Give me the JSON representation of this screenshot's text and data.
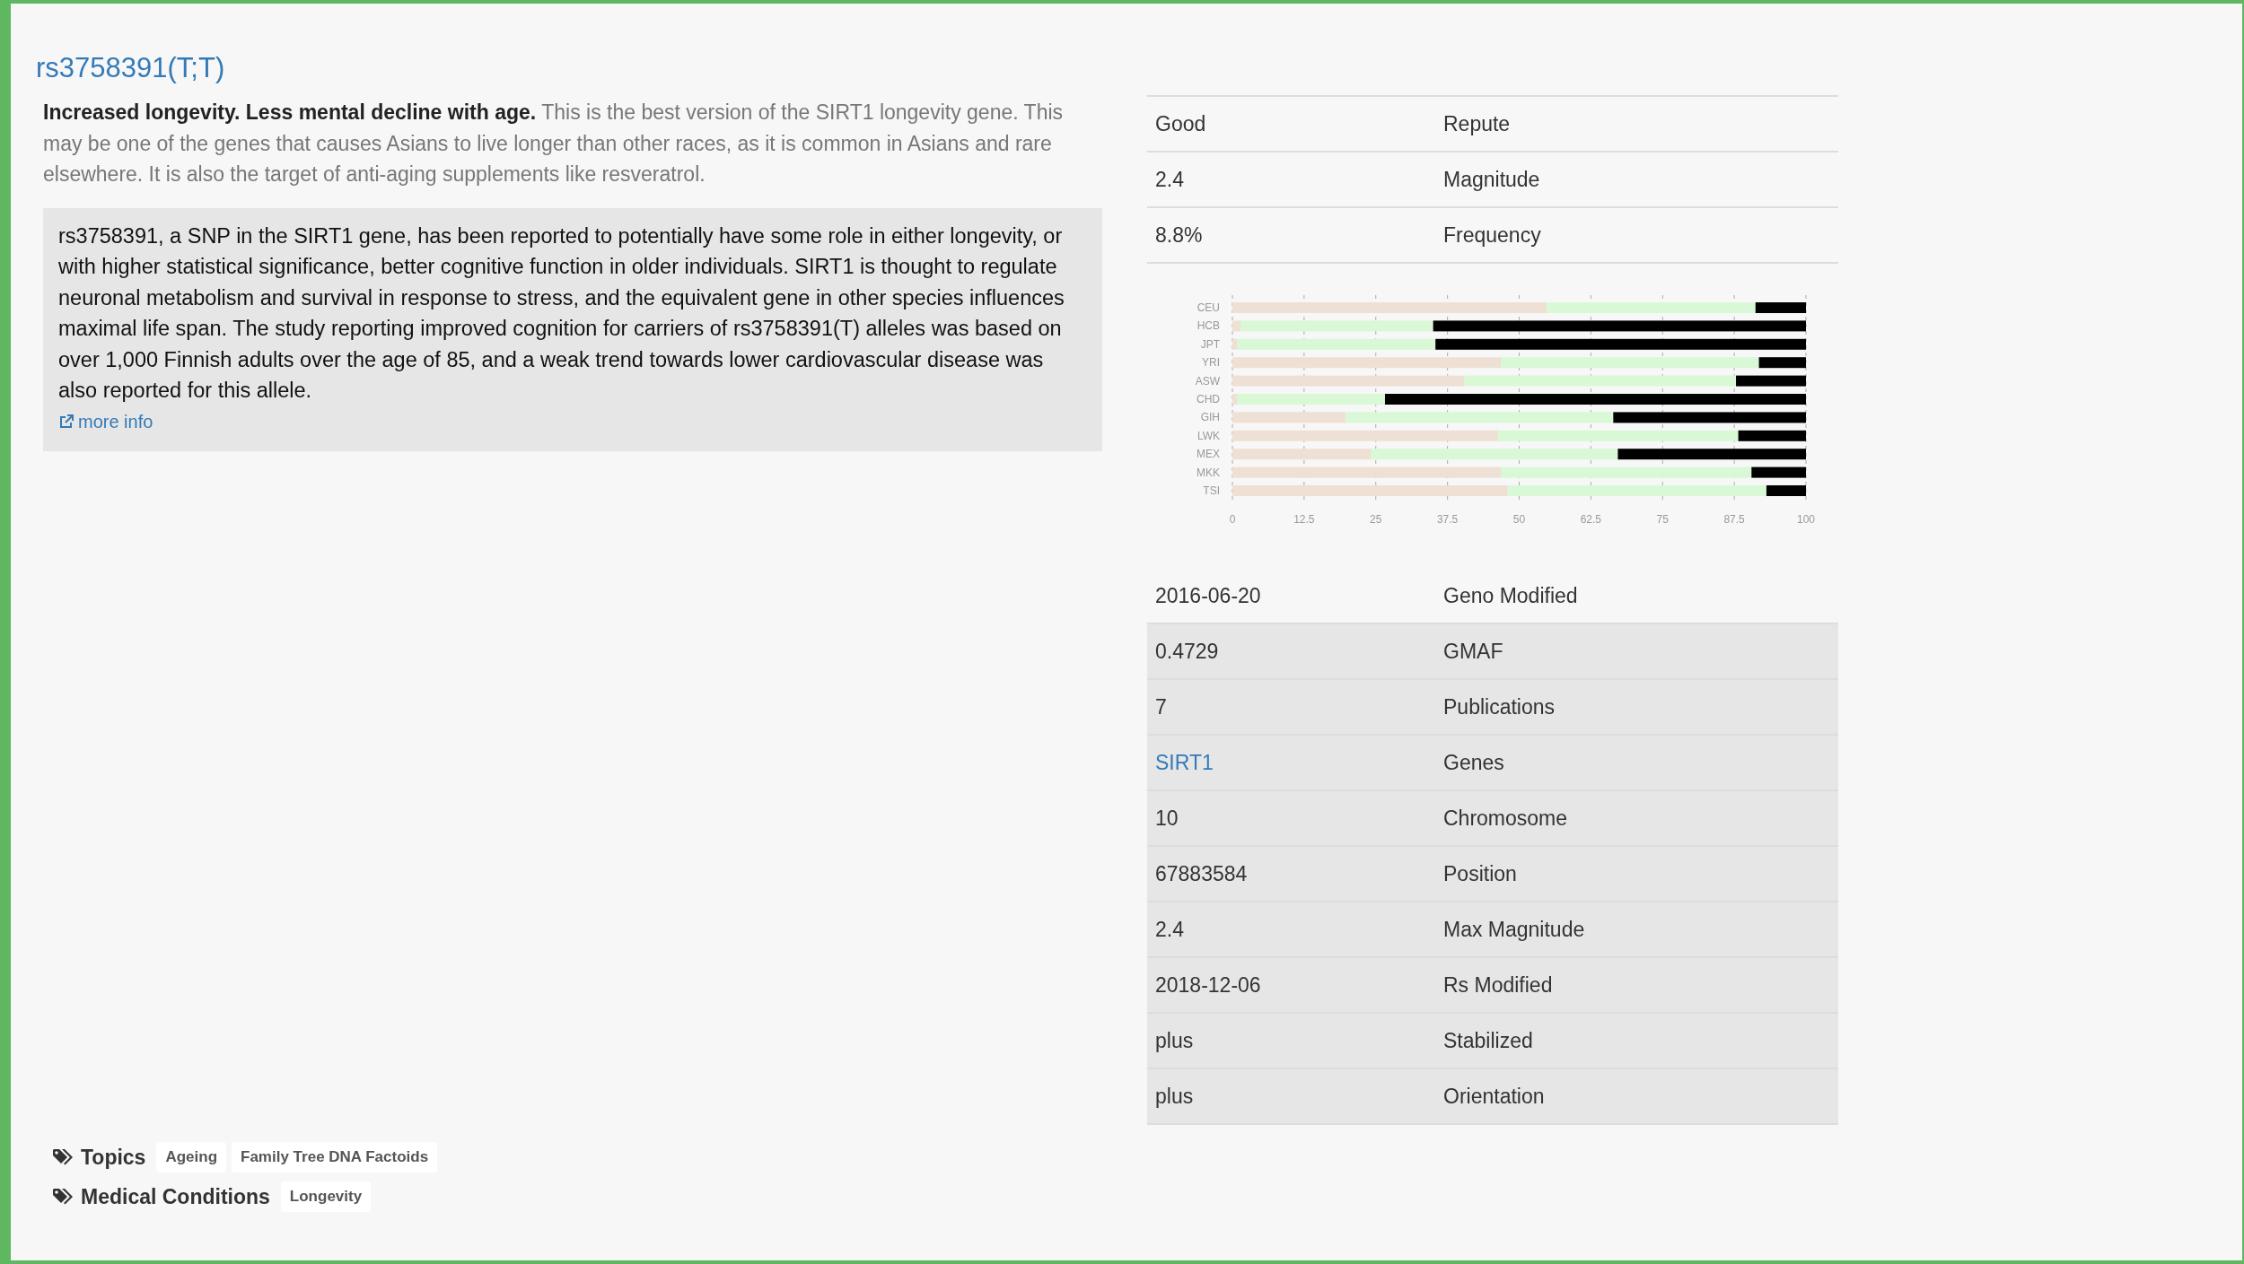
{
  "title": "rs3758391(T;T)",
  "summary": "**Increased longevity. Less mental decline with age.** This is the best version of the SIRT1 longevity gene. This may be one of the genes that causes Asians to live longer than other races, as it is common in Asians and rare elsewhere. It is also the target of anti-aging supplements like resveratrol.",
  "details_text": "rs3758391, a SNP in the SIRT1 gene, has been reported to potentially have some role in either longevity, or with higher statistical significance, better cognitive function in older individuals. SIRT1 is thought to regulate neuronal metabolism and survival in response to stress, and the equivalent gene in other species influences maximal life span. The study reporting improved cognition for carriers of rs3758391(T) alleles was based on over 1,000 Finnish adults over the age of 85, and a weak trend towards lower cardiovascular disease was also reported for this allele.",
  "more_info_link": "more info",
  "summary_table": [
    {
      "value": "Good",
      "label": "Repute"
    },
    {
      "value": "2.4",
      "label": "Magnitude"
    },
    {
      "value": "8.8%",
      "label": "Frequency"
    }
  ],
  "population_chart": {
    "chart_data": {
      "type": "bar",
      "orientation": "horizontal",
      "stacked": true,
      "categories": [
        "CEU",
        "HCB",
        "JPT",
        "YRI",
        "ASW",
        "CHD",
        "GIH",
        "LWK",
        "MEX",
        "MKK",
        "TSI"
      ],
      "series": [
        {
          "color": "#efe0d5",
          "values": [
            54.8,
            1.4,
            0.9,
            46.8,
            40.4,
            0.9,
            19.8,
            46.3,
            24.1,
            46.8,
            48.0
          ]
        },
        {
          "color": "#d9f8d6",
          "values": [
            36.4,
            33.6,
            34.5,
            45.0,
            47.4,
            25.7,
            46.6,
            41.9,
            43.1,
            43.7,
            45.1
          ]
        },
        {
          "color": "#000000",
          "values": [
            8.8,
            65.0,
            64.6,
            8.2,
            12.2,
            73.4,
            33.6,
            11.8,
            32.8,
            9.5,
            6.9
          ]
        }
      ],
      "grid": true,
      "xlim": [
        0,
        100
      ],
      "xticks": [
        0,
        12.5,
        25,
        37.5,
        50,
        62.5,
        75,
        87.5,
        100
      ]
    }
  },
  "details_table": [
    {
      "value": "2016-06-20",
      "label": "Geno Modified",
      "shaded": false,
      "kind": "text"
    },
    {
      "value": "0.4729",
      "label": "GMAF",
      "shaded": true,
      "kind": "text"
    },
    {
      "value": "7",
      "label": "Publications",
      "shaded": true,
      "kind": "text"
    },
    {
      "value": "SIRT1",
      "label": "Genes",
      "shaded": true,
      "kind": "link"
    },
    {
      "value": "10",
      "label": "Chromosome",
      "shaded": true,
      "kind": "text"
    },
    {
      "value": "67883584",
      "label": "Position",
      "shaded": true,
      "kind": "text"
    },
    {
      "value": "2.4",
      "label": "Max Magnitude",
      "shaded": true,
      "kind": "text"
    },
    {
      "value": "2018-12-06",
      "label": "Rs Modified",
      "shaded": true,
      "kind": "text"
    },
    {
      "value": "plus",
      "label": "Stabilized",
      "shaded": true,
      "kind": "text"
    },
    {
      "value": "plus",
      "label": "Orientation",
      "shaded": true,
      "kind": "text"
    }
  ],
  "tag_groups": [
    {
      "label": "Topics",
      "tags": [
        "Ageing",
        "Family Tree DNA Factoids"
      ]
    },
    {
      "label": "Medical Conditions",
      "tags": [
        "Longevity"
      ]
    }
  ]
}
